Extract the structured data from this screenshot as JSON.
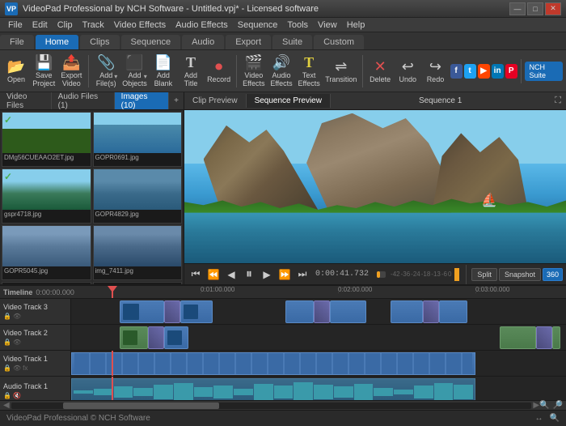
{
  "titleBar": {
    "icon": "VP",
    "title": "VideoPad Professional by NCH Software - Untitled.vpj* - Licensed software",
    "minLabel": "—",
    "maxLabel": "□",
    "closeLabel": "✕"
  },
  "menuBar": {
    "items": [
      "File",
      "Edit",
      "Clip",
      "Track",
      "Video Effects",
      "Audio Effects",
      "Sequence",
      "Tools",
      "View",
      "Help"
    ]
  },
  "tabs": {
    "items": [
      "File",
      "Home",
      "Clips",
      "Sequence",
      "Audio",
      "Export",
      "Suite",
      "Custom"
    ],
    "active": "Home"
  },
  "toolbar": {
    "buttons": [
      {
        "label": "Open",
        "icon": "📂"
      },
      {
        "label": "Save Project",
        "icon": "💾"
      },
      {
        "label": "Export Video",
        "icon": "📤"
      },
      {
        "label": "Add File(s)",
        "icon": "📎"
      },
      {
        "label": "Add Objects",
        "icon": "⬛"
      },
      {
        "label": "Add Blank",
        "icon": "📄"
      },
      {
        "label": "Add Title",
        "icon": "T"
      },
      {
        "label": "Record",
        "icon": "⏺"
      },
      {
        "label": "Video Effects",
        "icon": "🎬"
      },
      {
        "label": "Audio Effects",
        "icon": "🔊"
      },
      {
        "label": "Text Effects",
        "icon": "T"
      },
      {
        "label": "Transition",
        "icon": "⇌"
      },
      {
        "label": "Delete",
        "icon": "✕"
      },
      {
        "label": "Undo",
        "icon": "↩"
      },
      {
        "label": "Redo",
        "icon": "↪"
      }
    ],
    "ncaSuite": "NCH Suite"
  },
  "mediaTabs": {
    "items": [
      "Video Files",
      "Audio Files (1)",
      "Images (10)"
    ],
    "active": "Images (10)"
  },
  "mediaFiles": [
    {
      "name": "DMg56CUEAAO2ET.jpg",
      "class": "mt-1",
      "checked": true
    },
    {
      "name": "GOPR0691.jpg",
      "class": "mt-2",
      "checked": false
    },
    {
      "name": "gspr4718.jpg",
      "class": "mt-3",
      "checked": true
    },
    {
      "name": "GOPR4829.jpg",
      "class": "mt-4",
      "checked": false
    },
    {
      "name": "GOPR5045.jpg",
      "class": "mt-5",
      "checked": false
    },
    {
      "name": "img_7411.jpg",
      "class": "mt-6",
      "checked": false
    },
    {
      "name": "",
      "class": "",
      "checked": false,
      "placeholder": true
    },
    {
      "name": "",
      "class": "",
      "checked": false,
      "placeholder": true
    }
  ],
  "preview": {
    "tabs": [
      "Clip Preview",
      "Sequence Preview"
    ],
    "active": "Sequence Preview",
    "title": "Sequence 1"
  },
  "playback": {
    "time": "0:00:41.732",
    "splitLabel": "Split",
    "snapshotLabel": "Snapshot",
    "vrLabel": "360"
  },
  "timeline": {
    "label": "Timeline",
    "currentTime": "0:00:00.000",
    "rulerMarks": [
      "0:01:00.000",
      "0:02:00.000",
      "0:03:00.000"
    ],
    "tracks": [
      {
        "name": "Video Track 3",
        "type": "video"
      },
      {
        "name": "Video Track 2",
        "type": "video"
      },
      {
        "name": "Video Track 1",
        "type": "video"
      },
      {
        "name": "Audio Track 1",
        "type": "audio"
      }
    ]
  },
  "statusBar": {
    "text": "VideoPad Professional © NCH Software",
    "rightIcons": [
      "↔",
      "🔍"
    ]
  }
}
